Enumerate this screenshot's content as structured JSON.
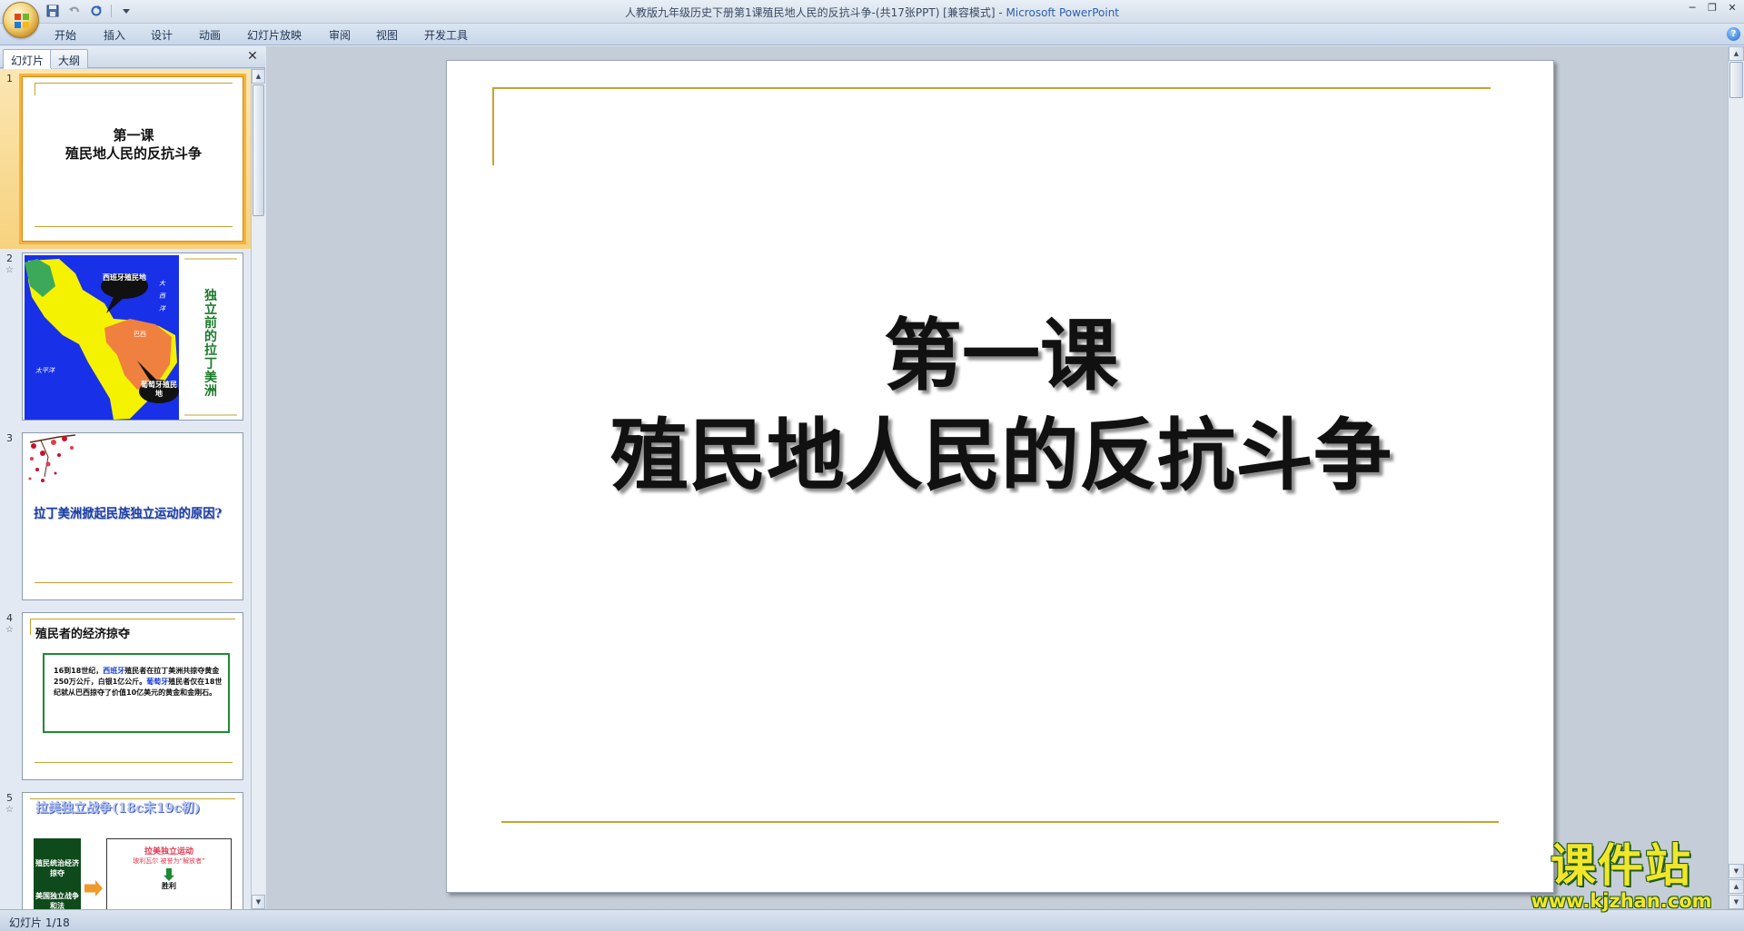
{
  "titlebar": {
    "document_title": "人教版九年级历史下册第1课殖民地人民的反抗斗争-(共17张PPT) [兼容模式] - ",
    "app_name": "Microsoft PowerPoint"
  },
  "ribbon": {
    "tabs": [
      "开始",
      "插入",
      "设计",
      "动画",
      "幻灯片放映",
      "审阅",
      "视图",
      "开发工具"
    ]
  },
  "left_pane": {
    "tabs": [
      "幻灯片",
      "大纲"
    ],
    "thumbnails": [
      {
        "number": "1",
        "title_line1": "第一课",
        "title_line2": "殖民地人民的反抗斗争"
      },
      {
        "number": "2",
        "callout_spain": "西班牙殖民地",
        "callout_brazil": "巴西",
        "callout_portugal": "葡萄牙殖民地",
        "ocean_pacific": "太平洋",
        "ocean_atlantic": "大西洋",
        "side_title": "独立前的拉丁美洲"
      },
      {
        "number": "3",
        "question": "拉丁美洲掀起民族独立运动的原因?"
      },
      {
        "number": "4",
        "heading": "殖民者的经济掠夺",
        "body_pre": "16到18世纪，",
        "body_spain": "西班牙",
        "body_mid": "殖民者在拉丁美洲共掠夺黄金250万公斤，白银1亿公斤。",
        "body_portugal": "葡萄牙",
        "body_post": "殖民者仅在18世纪就从巴西掠夺了价值10亿美元的黄金和金刚石。"
      },
      {
        "number": "5",
        "heading": "拉美独立战争(18c末19c初)",
        "box_a": "殖民统治经济掠夺",
        "box_b": "美国独立战争和法",
        "flow_top": "拉美独立运动",
        "flow_sub": "玻利瓦尔 被誉为“解放者”",
        "flow_bottom": "胜利"
      }
    ]
  },
  "slide": {
    "title_line1": "第一课",
    "title_line2": "殖民地人民的反抗斗争"
  },
  "statusbar": {
    "slide_indicator": "幻灯片 1/18"
  },
  "watermark": {
    "text": "课件站",
    "url": "www.kjzhan.com"
  },
  "colors": {
    "gold_line": "#c9a12f",
    "selection": "#f6b23c",
    "app_name": "#2b5fb0"
  }
}
